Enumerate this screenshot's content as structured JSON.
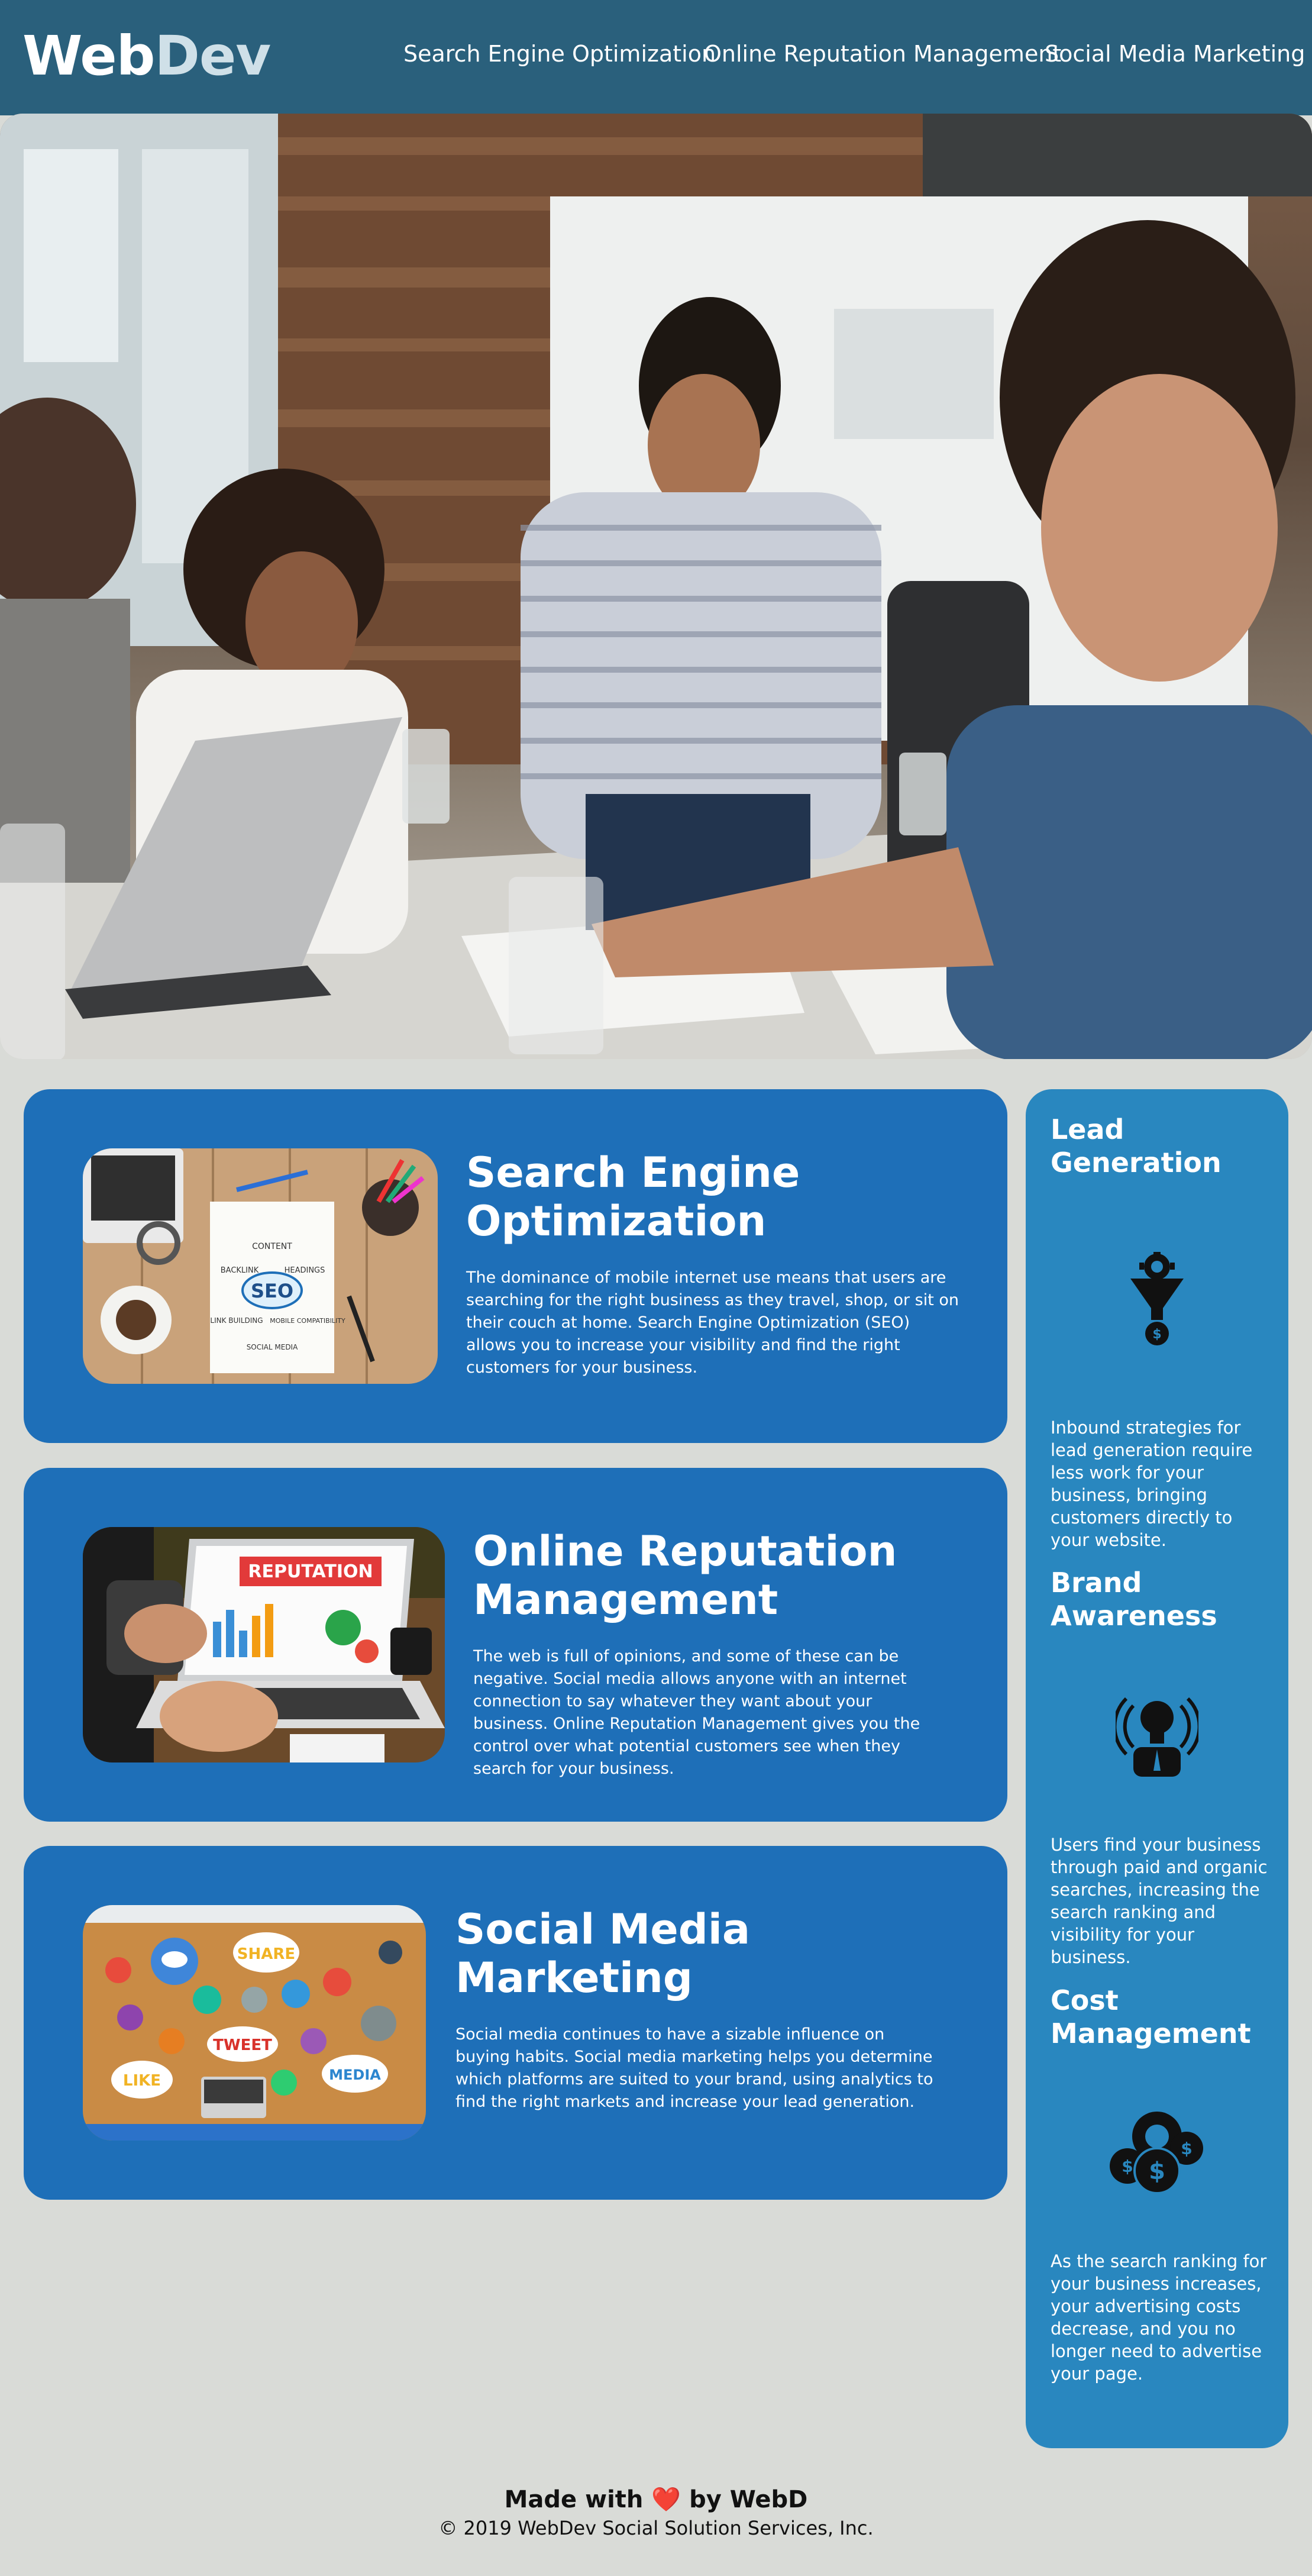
{
  "header": {
    "logo_part1": "Web",
    "logo_part2": "Dev",
    "nav": [
      {
        "label": "Search Engine Optimization"
      },
      {
        "label": "Online Reputation Management"
      },
      {
        "label": "Social Media Marketing"
      }
    ]
  },
  "hero": {
    "image": "team-meeting-photo"
  },
  "services": [
    {
      "title": "Search Engine Optimization",
      "text": "The dominance of mobile internet use means that users are searching for the right business as they travel, shop, or sit on their couch at home. Search Engine Optimization (SEO) allows you to increase your visibility and find the right customers for your business.",
      "image": "seo-notebook-image",
      "image_words": [
        "SEO",
        "CONTENT",
        "BACKLINK",
        "HEADINGS",
        "LINK BUILDING",
        "MOBILE COMPATIBILITY",
        "SOCIAL MEDIA"
      ]
    },
    {
      "title": "Online Reputation Management",
      "text": "The web is full of opinions, and some of these can be negative. Social media allows anyone with an internet connection to say whatever they want about your business. Online Reputation Management gives you the control over what potential customers see when they search for your business.",
      "image": "reputation-laptop-image",
      "image_words": [
        "REPUTATION"
      ]
    },
    {
      "title": "Social Media Marketing",
      "text": "Social media continues to have a sizable influence on buying habits. Social media marketing helps you determine which platforms are suited to your brand, using analytics to find the right markets and increase your lead generation.",
      "image": "social-media-table-image",
      "image_words": [
        "SHARE",
        "TWEET",
        "LIKE",
        "MEDIA"
      ]
    }
  ],
  "benefits": [
    {
      "title": "Lead Generation",
      "icon": "funnel-gear-icon",
      "text": "Inbound strategies for lead generation require less work for your business, bringing customers directly to your website."
    },
    {
      "title": "Brand Awareness",
      "icon": "lightbulb-person-icon",
      "text": "Users find your business through paid and organic searches, increasing the search ranking and visibility for your business."
    },
    {
      "title": "Cost Management",
      "icon": "money-gears-icon",
      "text": "As the search ranking for your business increases, your advertising costs decrease, and you no longer need to advertise your page."
    }
  ],
  "footer": {
    "made_prefix": "Made with",
    "heart": "❤️",
    "made_suffix": "by WebD",
    "copyright": "© 2019 WebDev Social Solution Services, Inc."
  },
  "colors": {
    "header_bg": "#2a607c",
    "page_bg": "#d9dbd7",
    "card_bg": "#1e6fb8",
    "aside_bg": "#2987bf"
  }
}
